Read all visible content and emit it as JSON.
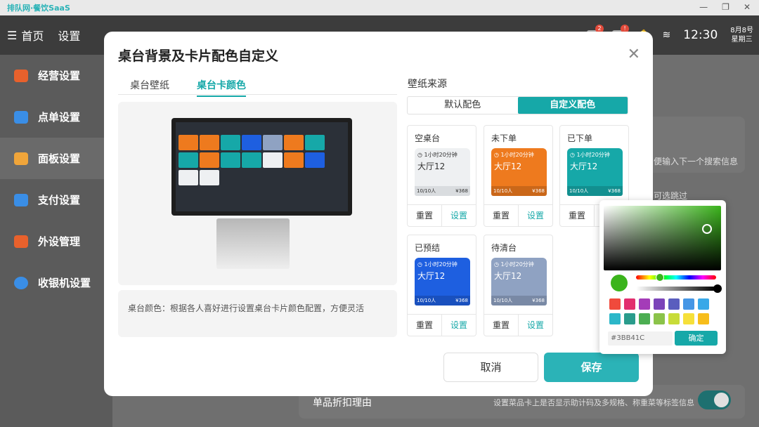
{
  "app": {
    "title": "排队网·餐饮SaaS"
  },
  "topbar": {
    "menu_label": "首页",
    "settings_label": "设置",
    "badge1": "2",
    "badge2": "!",
    "time": "12:30",
    "date": "8月8号",
    "weekday": "星期三"
  },
  "sidebar": {
    "items": [
      {
        "label": "经营设置"
      },
      {
        "label": "点单设置"
      },
      {
        "label": "面板设置"
      },
      {
        "label": "支付设置"
      },
      {
        "label": "外设管理"
      },
      {
        "label": "收银机设置"
      }
    ]
  },
  "background": {
    "search_hint": "便输入下一个搜索信息",
    "select_hint": "可选跳过",
    "row_label": "单品折扣理由",
    "row_desc": "设置菜品卡上是否显示助计码及多规格、称重菜等标签信息"
  },
  "modal": {
    "title": "桌台背景及卡片配色自定义",
    "tabs": [
      "桌台壁纸",
      "桌台卡颜色"
    ],
    "note": "桌台颜色：根据各人喜好进行设置桌台卡片颜色配置，方便灵活",
    "source_label": "壁纸来源",
    "source_options": [
      "默认配色",
      "自定义配色"
    ],
    "cards": [
      {
        "label": "空桌台",
        "time": "1小时20分钟",
        "name": "大厅12",
        "people": "10/10人",
        "price": "¥368",
        "color": "#eef0f2",
        "text": "#333333"
      },
      {
        "label": "未下单",
        "time": "1小时20分钟",
        "name": "大厅12",
        "people": "10/10人",
        "price": "¥368",
        "color": "#ee7a1e",
        "text": "#ffffff"
      },
      {
        "label": "已下单",
        "time": "1小时20分钟",
        "name": "大厅12",
        "people": "10/10人",
        "price": "¥368",
        "color": "#16a8a8",
        "text": "#ffffff"
      },
      {
        "label": "已预结",
        "time": "1小时20分钟",
        "name": "大厅12",
        "people": "10/10人",
        "price": "¥368",
        "color": "#1e5fe0",
        "text": "#ffffff"
      },
      {
        "label": "待清台",
        "time": "1小时20分钟",
        "name": "大厅12",
        "people": "10/10人",
        "price": "¥368",
        "color": "#8fa2c2",
        "text": "#ffffff"
      }
    ],
    "reset_label": "重置",
    "set_label": "设置",
    "cancel_label": "取消",
    "save_label": "保存"
  },
  "picker": {
    "hex": "#3BB41C",
    "confirm_label": "确定",
    "swatches": [
      "#f04a3c",
      "#e22f6e",
      "#a43cb8",
      "#7b44b9",
      "#5a5ebe",
      "#4596e5",
      "#38a8e8",
      "#2cb7c9",
      "#2a9c8c",
      "#4cae52",
      "#8bc34a",
      "#c8dc38",
      "#f6e03a",
      "#f7bd1b"
    ]
  }
}
